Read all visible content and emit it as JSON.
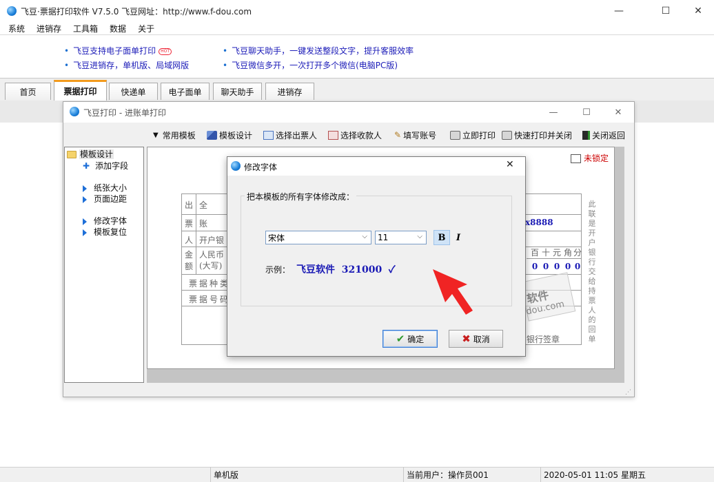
{
  "window": {
    "title": "飞豆·票据打印软件 V7.5.0  飞豆网址：http://www.f-dou.com",
    "controls": {
      "minimize": "—",
      "maximize": "☐",
      "close": "✕"
    }
  },
  "menu": [
    "系统",
    "进销存",
    "工具箱",
    "数据",
    "关于"
  ],
  "news": {
    "left": [
      "飞豆支持电子面单打印",
      "飞豆进销存，单机版、局域网版"
    ],
    "hot_badge": "HOT",
    "right": [
      "飞豆聊天助手，一键发送整段文字，提升客服效率",
      "飞豆微信多开，一次打开多个微信(电脑PC版)"
    ]
  },
  "tabs": [
    "首页",
    "票据打印",
    "快递单",
    "电子面单",
    "聊天助手",
    "进销存"
  ],
  "active_tab": "票据打印",
  "inner_window": {
    "title": "飞豆打印 - 进账单打印",
    "toolbar": [
      "常用模板",
      "模板设计",
      "选择出票人",
      "选择收款人",
      "填写账号",
      "立即打印",
      "快速打印并关闭",
      "关闭返回"
    ],
    "tree": {
      "root": "模板设计",
      "items": [
        "添加字段",
        "纸张大小",
        "页面边距",
        "修改字体",
        "模板复位"
      ]
    },
    "lock_label": "未锁定",
    "form": {
      "col_left": [
        "出",
        "票",
        "人",
        "金额"
      ],
      "rows": [
        "全",
        "账",
        "开户银",
        "人民币(大写)",
        "票据种类",
        "票据号码"
      ],
      "account_partial": "x8888",
      "digit_headers": [
        "百",
        "十",
        "元",
        "角",
        "分"
      ],
      "digits": [
        "0",
        "0",
        "0",
        "0",
        "0"
      ],
      "watermark": [
        "软件",
        "dou.com"
      ],
      "bank_sign": "银行签章",
      "vertical_note": "此联是开户银行交给持票人的回单"
    }
  },
  "dialog": {
    "title": "修改字体",
    "group_label": "把本模板的所有字体修改成：",
    "font_name": "宋体",
    "font_size": "11",
    "bold_label": "B",
    "italic_label": "I",
    "sample_label": "示例：",
    "sample_text": "飞豆软件  321000  ✓",
    "ok_label": "确定",
    "cancel_label": "取消"
  },
  "status": {
    "edition": "单机版",
    "user": "当前用户：操作员001",
    "datetime": "2020-05-01 11:05 星期五"
  }
}
